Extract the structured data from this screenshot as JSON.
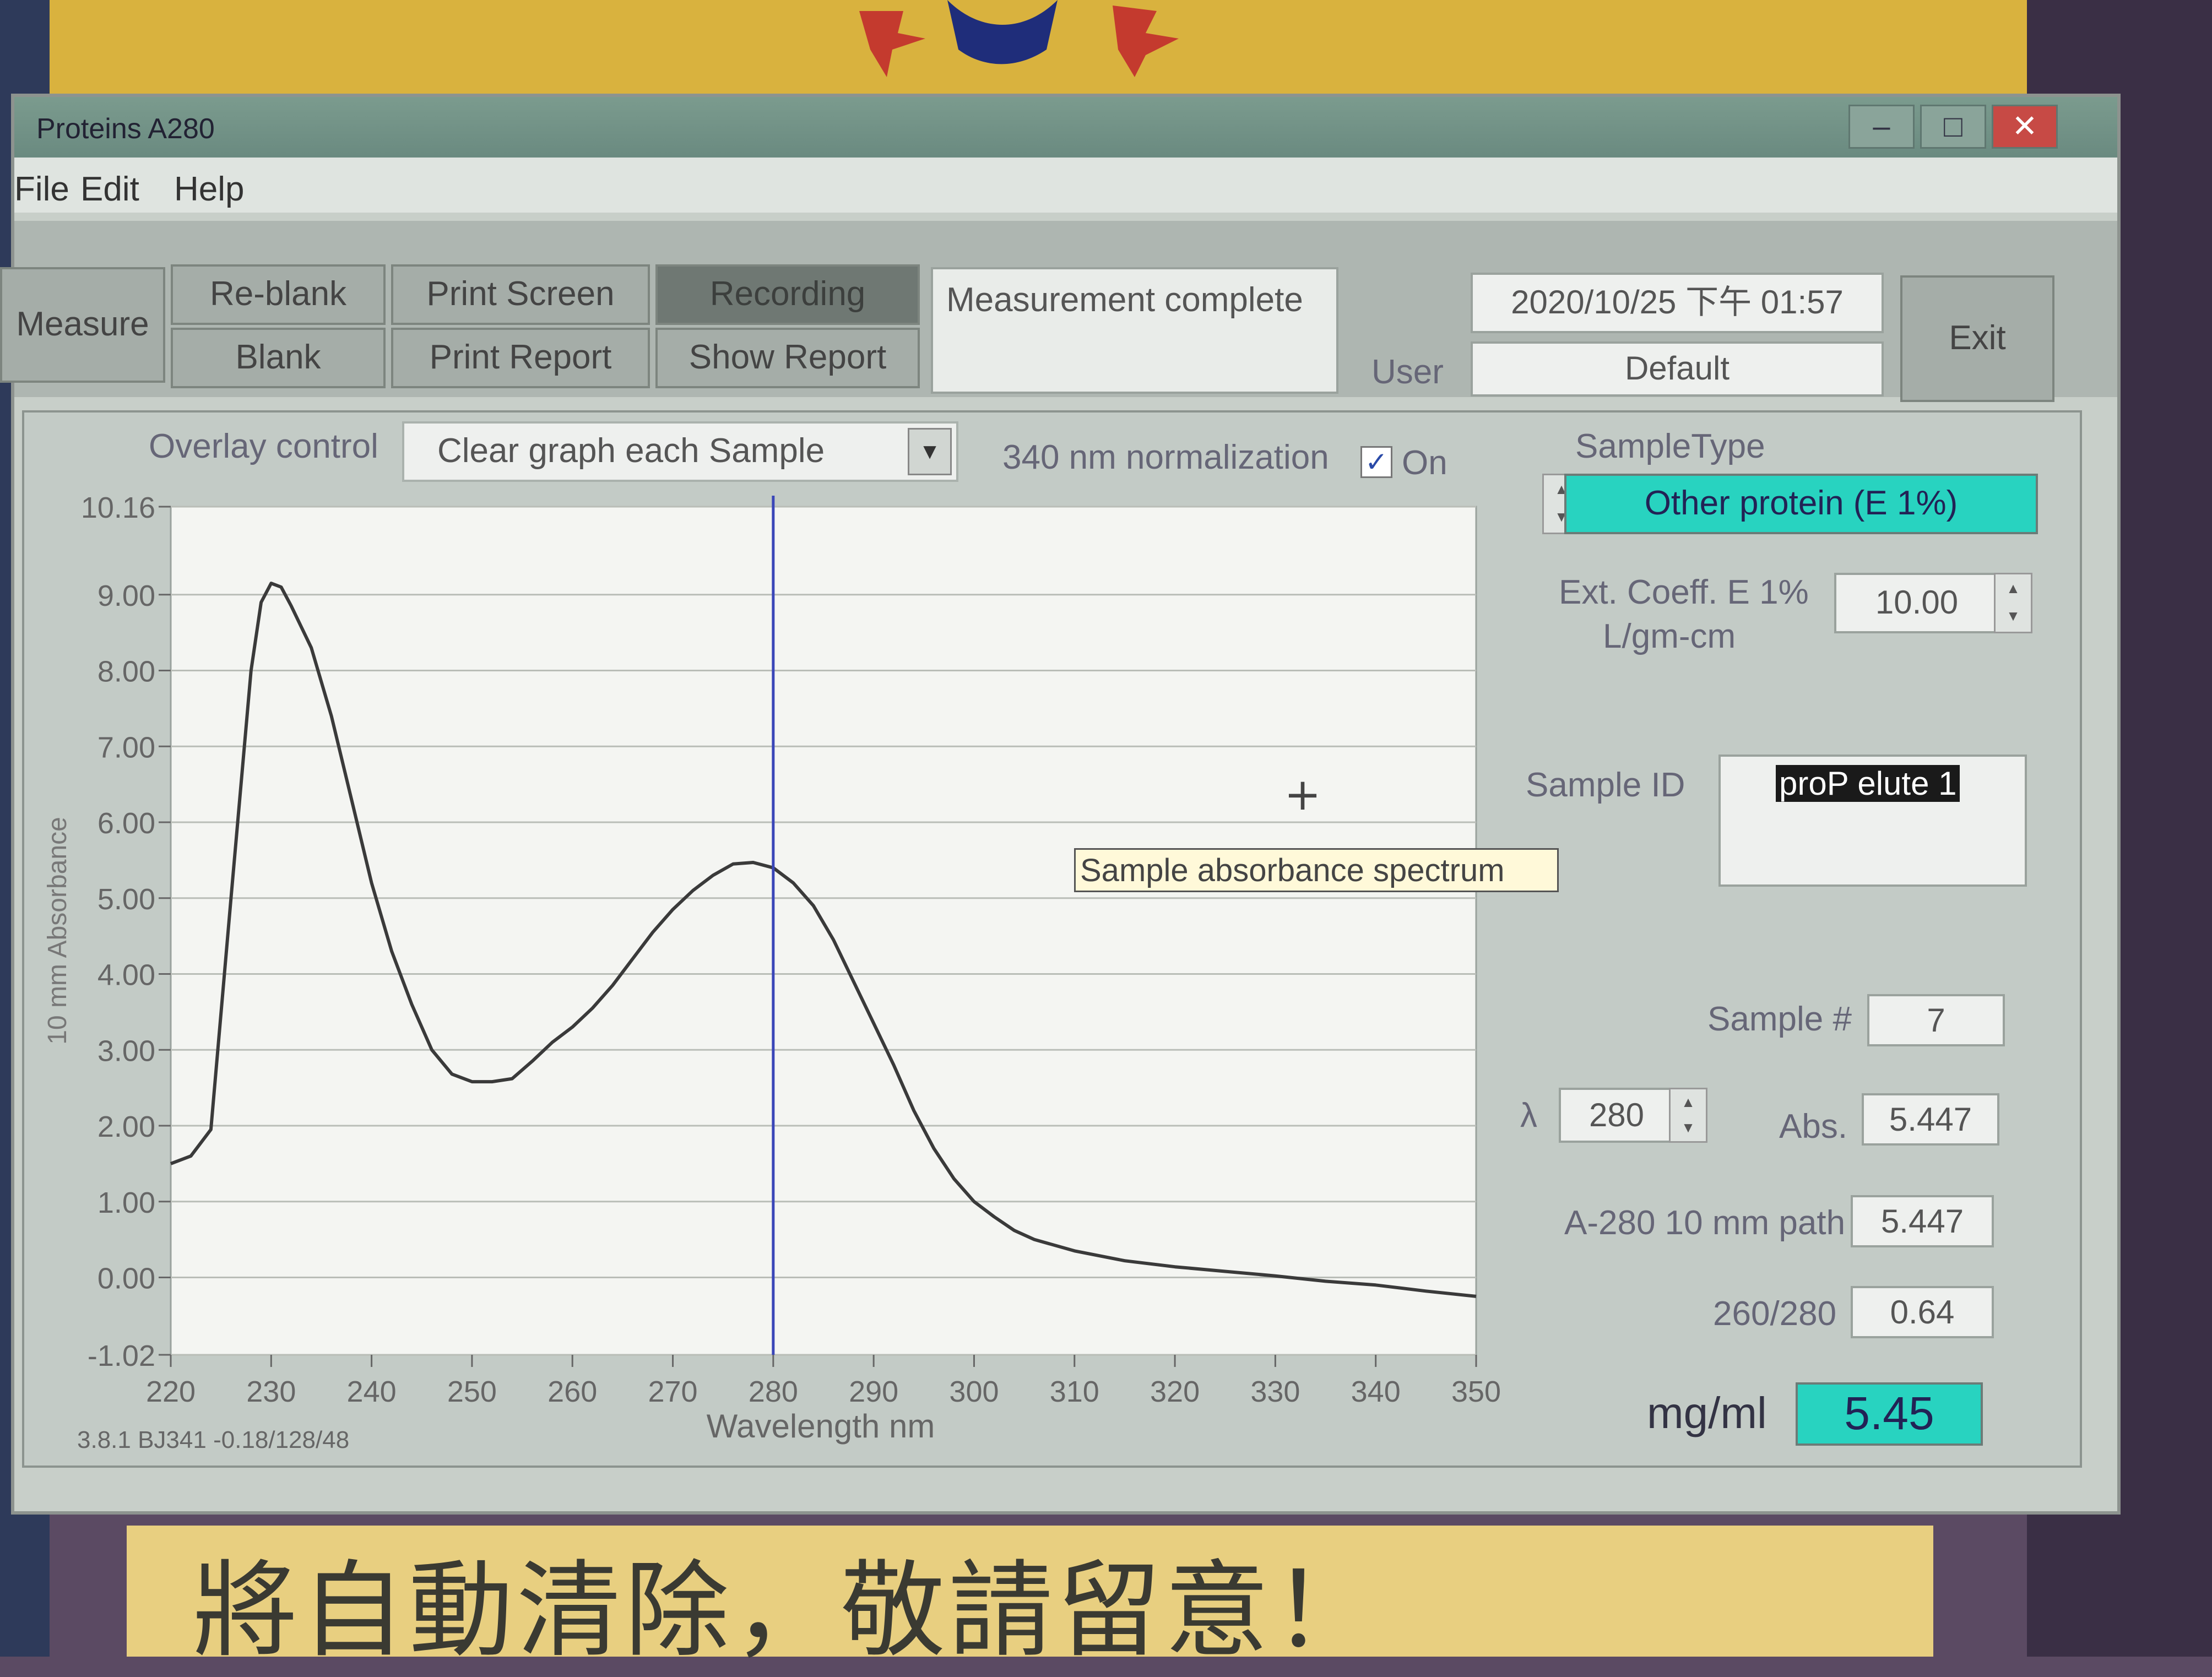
{
  "window": {
    "title": "Proteins A280",
    "controls": {
      "minimize": "–",
      "maximize": "□",
      "close": "✕"
    }
  },
  "menu": [
    "File",
    "Edit",
    "Help"
  ],
  "toolbar": {
    "measure": "Measure",
    "reblank": "Re-blank",
    "blank": "Blank",
    "print_screen": "Print Screen",
    "print_report": "Print Report",
    "recording": "Recording",
    "show_report": "Show Report",
    "status": "Measurement complete",
    "datetime": "2020/10/25 下午 01:57",
    "user_label": "User",
    "user_value": "Default",
    "exit": "Exit"
  },
  "overlay": {
    "label": "Overlay control",
    "selected": "Clear graph each Sample",
    "normalization_label": "340 nm normalization",
    "normalization_on": "On",
    "normalization_checked": true
  },
  "side": {
    "sample_type_label": "SampleType",
    "sample_type_value": "Other protein (E 1%)",
    "ext_coeff_label": "Ext. Coeff. E 1%",
    "ext_coeff_unit": "L/gm-cm",
    "ext_coeff_value": "10.00",
    "sample_id_label": "Sample ID",
    "sample_id_value": "proP elute 1",
    "sample_num_label": "Sample #",
    "sample_num_value": "7",
    "lambda_label": "λ",
    "lambda_value": "280",
    "abs_label": "Abs.",
    "abs_value": "5.447",
    "a280_label": "A-280 10 mm path",
    "a280_value": "5.447",
    "ratio_label": "260/280",
    "ratio_value": "0.64",
    "conc_label": "mg/ml",
    "conc_value": "5.45"
  },
  "tooltip": "Sample absorbance spectrum",
  "version": "3.8.1 BJ341 -0.18/128/48",
  "background_caption": "將自動清除，敬請留意！",
  "colors": {
    "accent_cyan": "#28d3c0",
    "cursor_line": "#3a46b8",
    "curve": "#3a3a3a"
  },
  "chart_data": {
    "type": "line",
    "xlabel": "Wavelength nm",
    "ylabel": "10 mm Absorbance",
    "xlim": [
      220,
      350
    ],
    "ylim": [
      -1.02,
      10.16
    ],
    "x_ticks": [
      "220",
      "230",
      "240",
      "250",
      "260",
      "270",
      "280",
      "290",
      "300",
      "310",
      "320",
      "330",
      "340",
      "350"
    ],
    "y_ticks": [
      "10.16",
      "9.00",
      "8.00",
      "7.00",
      "6.00",
      "5.00",
      "4.00",
      "3.00",
      "2.00",
      "1.00",
      "0.00",
      "-1.02"
    ],
    "cursor_x": 280,
    "grid": true,
    "series": [
      {
        "x": [
          220,
          222,
          224,
          226,
          228,
          229,
          230,
          231,
          232,
          234,
          236,
          238,
          240,
          242,
          244,
          246,
          248,
          250,
          252,
          254,
          256,
          258,
          260,
          262,
          264,
          266,
          268,
          270,
          272,
          274,
          276,
          278,
          280,
          282,
          284,
          286,
          288,
          290,
          292,
          294,
          296,
          298,
          300,
          302,
          304,
          306,
          310,
          315,
          320,
          325,
          330,
          335,
          340,
          345,
          350
        ],
        "y": [
          1.5,
          1.6,
          1.95,
          5.0,
          8.0,
          8.9,
          9.15,
          9.1,
          8.85,
          8.3,
          7.4,
          6.3,
          5.2,
          4.3,
          3.6,
          3.0,
          2.68,
          2.58,
          2.58,
          2.62,
          2.85,
          3.1,
          3.3,
          3.55,
          3.85,
          4.2,
          4.55,
          4.85,
          5.1,
          5.3,
          5.45,
          5.47,
          5.4,
          5.2,
          4.9,
          4.45,
          3.9,
          3.35,
          2.8,
          2.2,
          1.7,
          1.3,
          1.0,
          0.8,
          0.62,
          0.5,
          0.35,
          0.22,
          0.14,
          0.08,
          0.02,
          -0.05,
          -0.1,
          -0.18,
          -0.25
        ]
      }
    ]
  }
}
